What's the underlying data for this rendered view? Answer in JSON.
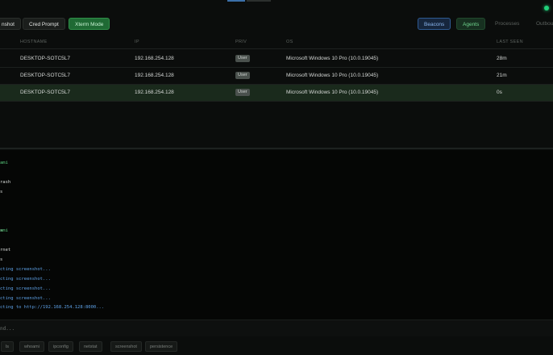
{
  "toolbar": {
    "screenshot_label": "nshot",
    "cred_prompt_label": "Cred Prompt",
    "xterm_label": "Xterm Mode",
    "tabs": {
      "beacons": "Beacons",
      "agents": "Agents",
      "processes": "Processes",
      "other": "Outbou"
    }
  },
  "table": {
    "columns": {
      "hostname": "HOSTNAME",
      "ip": "IP",
      "priv": "PRIV",
      "os": "OS",
      "last_seen": "LAST SEEN"
    },
    "rows": [
      {
        "hostname": "DESKTOP-SOTC5L7",
        "ip": "192.168.254.128",
        "priv": "User",
        "os": "Microsoft Windows 10 Pro (10.0.19045)",
        "last_seen": "28m"
      },
      {
        "hostname": "DESKTOP-SOTC5L7",
        "ip": "192.168.254.128",
        "priv": "User",
        "os": "Microsoft Windows 10 Pro (10.0.19045)",
        "last_seen": "21m"
      },
      {
        "hostname": "DESKTOP-SOTC5L7",
        "ip": "192.168.254.128",
        "priv": "User",
        "os": "Microsoft Windows 10 Pro (10.0.19045)",
        "last_seen": "0s"
      }
    ]
  },
  "console": {
    "lines": [
      {
        "text": "ami",
        "color": "green"
      },
      {
        "text": "",
        "color": "white"
      },
      {
        "text": "rash",
        "color": "white"
      },
      {
        "text": "s",
        "color": "white"
      },
      {
        "text": "",
        "color": "white"
      },
      {
        "text": "",
        "color": "white"
      },
      {
        "text": "",
        "color": "white"
      },
      {
        "text": "s",
        "color": "white"
      },
      {
        "text": "ami",
        "color": "green"
      },
      {
        "text": "",
        "color": "white"
      },
      {
        "text": "rnet",
        "color": "white"
      },
      {
        "text": "s",
        "color": "white"
      },
      {
        "text": "cting screenshot...",
        "color": "blue"
      },
      {
        "text": "cting screenshot...",
        "color": "blue"
      },
      {
        "text": "cting screenshot...",
        "color": "blue"
      },
      {
        "text": "cting screenshot...",
        "color": "blue"
      },
      {
        "text": "cting to http://192.168.254.128:8000...",
        "color": "blue"
      }
    ]
  },
  "input": {
    "placeholder": "nd..."
  },
  "quick_commands": [
    "ls",
    "whoami",
    "ipconfig",
    "netstat",
    "screenshot",
    "persistence"
  ],
  "colors": {
    "accent_green": "#21d07a",
    "beacons_blue": "#2e5a92",
    "selected_row": "#1a2a1c"
  }
}
